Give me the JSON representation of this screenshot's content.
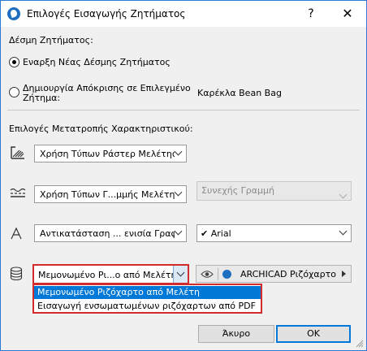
{
  "window": {
    "title": "Επιλογές Εισαγωγής Ζητήματος",
    "help_glyph": "?",
    "close_glyph": "✕"
  },
  "bundle": {
    "heading": "Δέσμη Ζητήματος:",
    "option_new": "Εναρξη Νέας Δέσμης Ζητήματος",
    "option_reply_line1": "Δημιουργία Απόκρισης σε Επιλεγμένο",
    "option_reply_line2": "Ζήτημα:",
    "selected_issue": "Καρέκλα Bean Bag",
    "selected_option": "new"
  },
  "conversion": {
    "heading": "Επιλογές Μετατροπής Χαρακτηριστικού:",
    "rows": [
      {
        "icon": "fill-pattern-icon",
        "value": "Χρήση Τύπων Ράστερ Μελέτης"
      },
      {
        "icon": "line-type-icon",
        "value": "Χρήση Τύπων Γ...μμής Μελέτης",
        "secondary": "Συνεχής Γραμμή"
      },
      {
        "icon": "font-icon",
        "value": "Αντικατάσταση ... ενισία Γραφή",
        "secondary": "Arial"
      },
      {
        "icon": "pen-set-icon",
        "value": "Μεμονωμένο Ρι...ο από Μελέτη",
        "secondary": "ARCHICAD Ριζόχαρτο"
      }
    ]
  },
  "dropdown": {
    "options": [
      "Μεμονωμένο Ριζόχαρτο από Μελέτη",
      "Εισαγωγή ενσωματωμένων ριζόχαρτων από PDF"
    ],
    "selected_index": 0
  },
  "buttons": {
    "cancel": "Άκυρο",
    "ok": "OK"
  },
  "colors": {
    "highlight": "#d22b2b",
    "selection": "#0078d7"
  }
}
